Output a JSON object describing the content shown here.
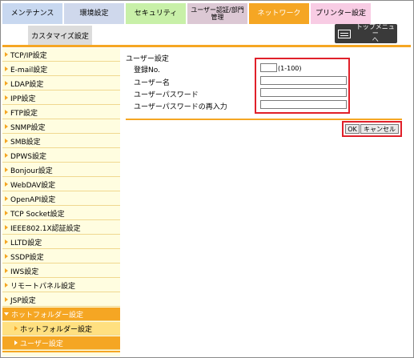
{
  "tabs": {
    "maintenance": "メンテナンス",
    "environment": "環境設定",
    "security": "セキュリティ",
    "user_auth_line1": "ユーザー認証/部門",
    "user_auth_line2": "管理",
    "network": "ネットワーク",
    "printer": "プリンター設定"
  },
  "subbar": {
    "custom": "カスタマイズ設定",
    "topmenu_line1": "トップメニュー",
    "topmenu_line2": "へ"
  },
  "sidebar": {
    "items": [
      "TCP/IP設定",
      "E-mail設定",
      "LDAP設定",
      "IPP設定",
      "FTP設定",
      "SNMP設定",
      "SMB設定",
      "DPWS設定",
      "Bonjour設定",
      "WebDAV設定",
      "OpenAPI設定",
      "TCP Socket設定",
      "IEEE802.1X認証設定",
      "LLTD設定",
      "SSDP設定",
      "IWS設定",
      "リモートパネル設定",
      "JSP設定"
    ],
    "open_item": "ホットフォルダー設定",
    "sub_item": "ホットフォルダー設定",
    "active_item": "ユーザー設定"
  },
  "main": {
    "section_title": "ユーザー設定",
    "reg_label": "登録No.",
    "reg_hint": "(1-100)",
    "user_label": "ユーザー名",
    "pass_label": "ユーザーパスワード",
    "pass2_label": "ユーザーパスワードの再入力",
    "ok": "OK",
    "cancel": "キャンセル"
  },
  "colors": {
    "accent": "#f5a623",
    "highlight": "#e0202a",
    "sidebar_bg": "#fffde0"
  }
}
